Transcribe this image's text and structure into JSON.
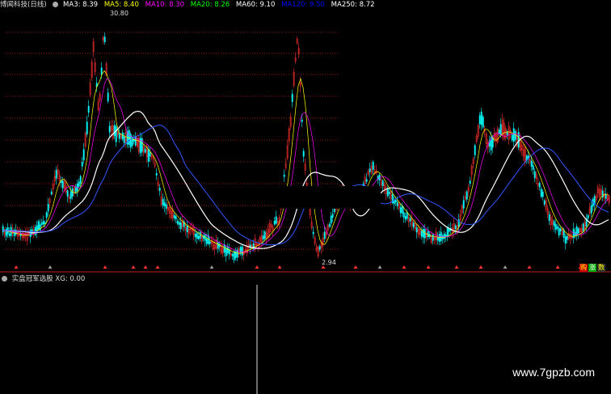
{
  "legend": {
    "title": "博闻科技(日线)",
    "items": [
      {
        "label": "MA3: 8.39",
        "color": "#ffffff"
      },
      {
        "label": "MA5: 8.40",
        "color": "#ffff00"
      },
      {
        "label": "MA10: 8.30",
        "color": "#ff00ff"
      },
      {
        "label": "MA20: 8.26",
        "color": "#00ff00"
      },
      {
        "label": "MA60: 9.10",
        "color": "#ffffff"
      },
      {
        "label": "MA120: 9.50",
        "color": "#0000ff"
      },
      {
        "label": "MA250: 8.72",
        "color": "#ffffff"
      }
    ]
  },
  "price_high_label": "30.80",
  "price_low_label": "2.94",
  "sub_legend": "实盘冠军选股 XG: 0.00",
  "corner_buttons": [
    "购",
    "涨",
    "数"
  ],
  "watermark": "www.7gpzb.com",
  "colors": {
    "grid": "#8b1a1a",
    "up": "#ff3030",
    "down": "#00ffff",
    "ma": "#ffffff"
  }
}
